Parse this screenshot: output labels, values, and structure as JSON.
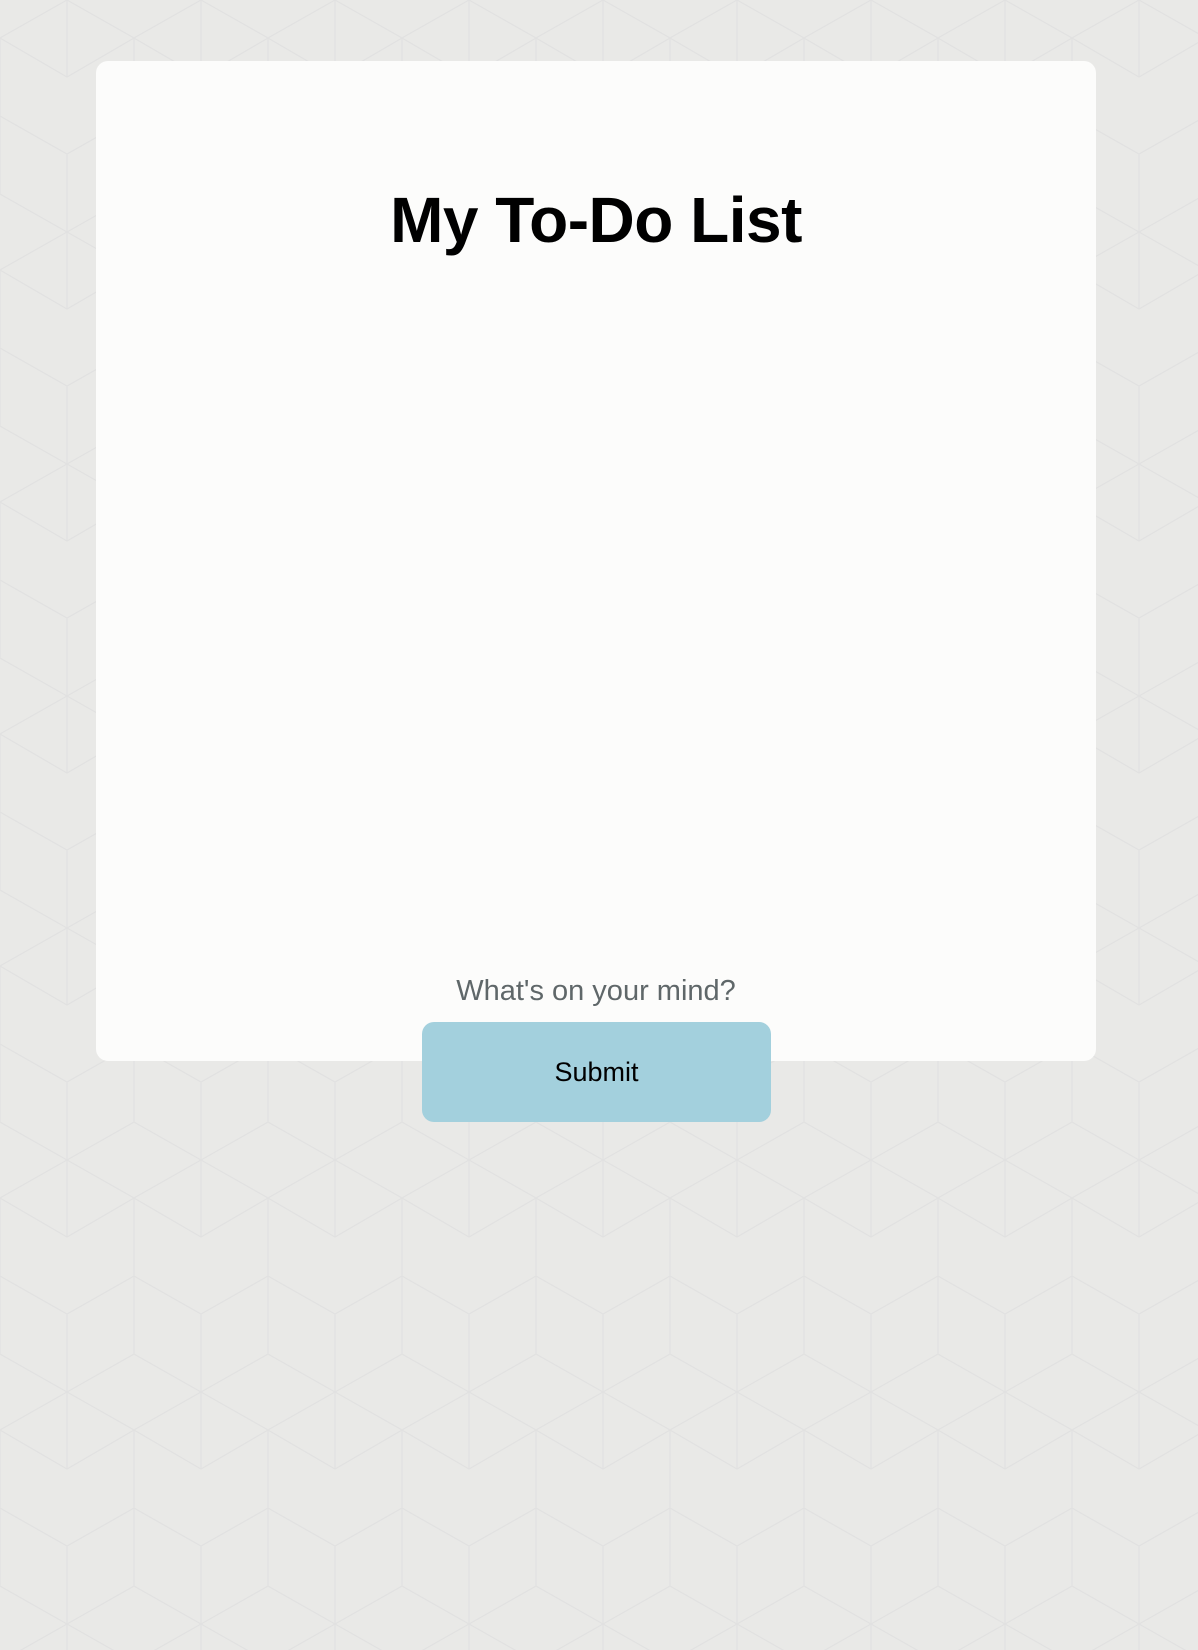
{
  "app": {
    "title": "My To-Do List"
  },
  "form": {
    "input_placeholder": "What's on your mind?",
    "input_value": "",
    "submit_label": "Submit"
  },
  "tasks": [],
  "colors": {
    "page_background": "#e9e9e7",
    "card_background": "#fcfcfb",
    "submit_button": "#a3d0dd",
    "placeholder_text": "#5f6769"
  }
}
